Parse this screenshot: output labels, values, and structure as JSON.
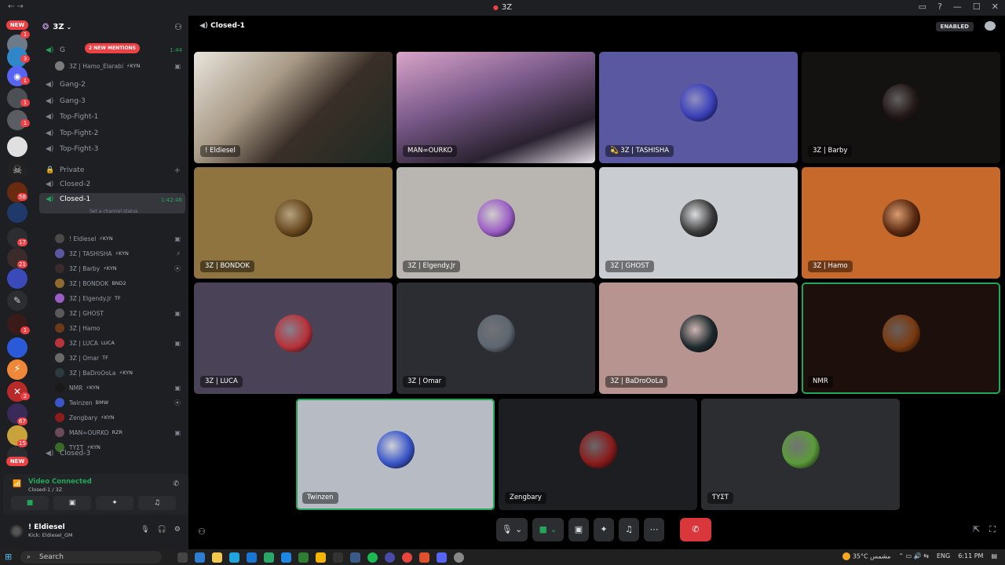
{
  "window": {
    "title": "3Z",
    "controls": [
      "▭",
      "?",
      "—",
      "☐",
      "✕"
    ]
  },
  "rail": {
    "new_top": "NEW",
    "new_bottom": "NEW",
    "badges": [
      "1",
      "3",
      "1",
      "1",
      "1",
      "58",
      "17",
      "21",
      "1",
      "67",
      "15",
      "2"
    ]
  },
  "server": {
    "name": "3Z",
    "mentions_pill": "2 NEW MENTIONS"
  },
  "channels": [
    {
      "name": "G",
      "time": "1:44",
      "active_voice": true
    },
    {
      "name": "Gang-2"
    },
    {
      "name": "Gang-3"
    },
    {
      "name": "Top-Fight-1"
    },
    {
      "name": "Top-Fight-2"
    },
    {
      "name": "Top-Fight-3"
    },
    {
      "name": "Private"
    },
    {
      "name": "Closed-2"
    },
    {
      "name": "Closed-1",
      "time": "1:42:46"
    },
    {
      "name": "Closed-3"
    }
  ],
  "channel_status_hint": "Set a channel status",
  "g_user": {
    "name": "3Z | Hamo_Elarabi",
    "tag": "⚡KYN"
  },
  "voice_users": [
    {
      "name": "! Eldiesel",
      "tag": "⚡KYN"
    },
    {
      "name": "3Z | TASHISHA",
      "tag": "⚡KYN"
    },
    {
      "name": "3Z | Barby",
      "tag": "⚡KYN"
    },
    {
      "name": "3Z | BONDOK",
      "tag": "BND2"
    },
    {
      "name": "3Z | Elgendy.Jr",
      "tag": "TF"
    },
    {
      "name": "3Z | GHOST",
      "tag": ""
    },
    {
      "name": "3Z | Hamo",
      "tag": ""
    },
    {
      "name": "3Z | LUCA",
      "tag": "LUCA"
    },
    {
      "name": "3Z | Omar",
      "tag": "TF"
    },
    {
      "name": "3Z | BaDroOoLa",
      "tag": "⚡KYN"
    },
    {
      "name": "NMR",
      "tag": "⚡KYN"
    },
    {
      "name": "Twinzen",
      "tag": "BMW"
    },
    {
      "name": "Zengbary",
      "tag": "⚡KYN"
    },
    {
      "name": "MAN∞OURKO",
      "tag": "RZR"
    },
    {
      "name": "ƬΥΣƬ",
      "tag": "⚡KYN"
    }
  ],
  "voice_panel": {
    "status": "Video Connected",
    "location": "Closed-1 / 3Z",
    "buttons": [
      "camera",
      "screen",
      "activities",
      "soundboard"
    ]
  },
  "me": {
    "name": "! Eldiesel",
    "status": "Kick: Eldiesel_GM"
  },
  "stage": {
    "channel": "Closed-1",
    "enabled_label": "ENABLED"
  },
  "tiles": [
    {
      "name": "! Eldiesel",
      "bg": "#6b5a48",
      "video": true
    },
    {
      "name": "MAN∞OURKO",
      "bg": "#8a6a8f",
      "video": true
    },
    {
      "name": "💫 3Z | TASHISHA",
      "bg": "#5a58a0",
      "av": "#3a3fb8"
    },
    {
      "name": "3Z | Barby",
      "bg": "#141111",
      "av": "#241818"
    },
    {
      "name": "3Z | BONDOK",
      "bg": "#8f7440",
      "av": "#6a4a20"
    },
    {
      "name": "3Z | Elgendy.Jr",
      "bg": "#b9b6b2",
      "av": "#9b5ec6"
    },
    {
      "name": "3Z | GHOST",
      "bg": "#c9ccd1",
      "av": "#3b3b3b"
    },
    {
      "name": "3Z | Hamo",
      "bg": "#c7692a",
      "av": "#5a2a10"
    },
    {
      "name": "3Z | LUCA",
      "bg": "#4a4256",
      "av": "#b8333b"
    },
    {
      "name": "3Z | Omar",
      "bg": "#2b2d33",
      "av": "#5e6670"
    },
    {
      "name": "3Z | BaDroOoLa",
      "bg": "#b7948f",
      "av": "#1f2a2e"
    },
    {
      "name": "NMR",
      "bg": "#1c0f0c",
      "av": "#7a3a10",
      "speaking": true
    },
    {
      "name": "Twinzen",
      "bg": "#b7bcc4",
      "av": "#3a56c8",
      "speaking": true
    },
    {
      "name": "Zengbary",
      "bg": "#1d1e21",
      "av": "#8a1c1c"
    },
    {
      "name": "ƬΥΣƬ",
      "bg": "#2b2d31",
      "av": "#5b9b3a"
    }
  ],
  "taskbar": {
    "search_placeholder": "Search",
    "weather": "35°C",
    "weather_desc": "مشمس",
    "lang": "ENG",
    "time": "6:11 PM"
  }
}
